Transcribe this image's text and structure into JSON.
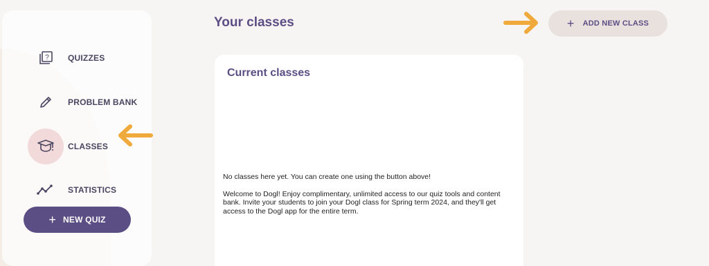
{
  "sidebar": {
    "items": [
      {
        "label": "QUIZZES",
        "icon": "quiz-icon"
      },
      {
        "label": "PROBLEM BANK",
        "icon": "pencil-icon"
      },
      {
        "label": "CLASSES",
        "icon": "graduation-cap-icon",
        "active": true
      },
      {
        "label": "STATISTICS",
        "icon": "line-chart-icon"
      }
    ],
    "new_quiz_label": "NEW QUIZ"
  },
  "header": {
    "title": "Your classes",
    "add_class_label": "ADD NEW CLASS"
  },
  "main": {
    "card_title": "Current classes",
    "empty_message": "No classes here yet. You can create one using the button above!",
    "welcome_message": "Welcome to Dogl! Enjoy complimentary, unlimited access to our quiz tools and content bank. Invite your students to join your Dogl class for Spring term 2024, and they'll get access to the Dogl app for the entire term."
  },
  "colors": {
    "accent": "#5b4e84",
    "annotation_arrow": "#f0aa3c",
    "active_highlight": "#f2dada",
    "background": "#f6f5f4"
  }
}
